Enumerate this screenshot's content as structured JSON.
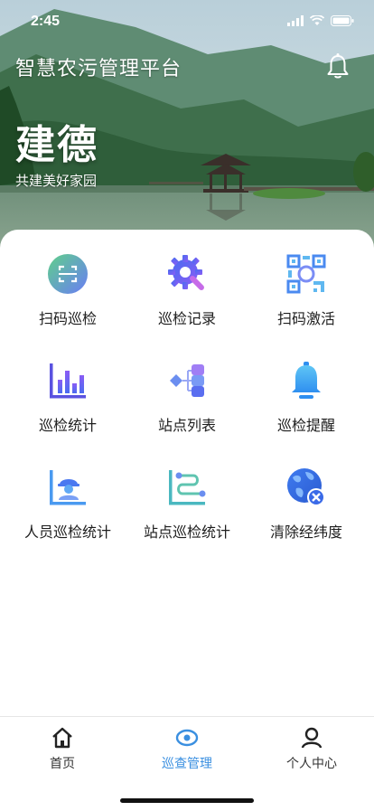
{
  "status_bar": {
    "time": "2:45"
  },
  "header": {
    "title": "智慧农污管理平台",
    "bell_icon": "bell-icon"
  },
  "hero": {
    "city": "建德",
    "slogan": "共建美好家园"
  },
  "menu": [
    {
      "label": "扫码巡检",
      "icon": "scan-code-icon"
    },
    {
      "label": "巡检记录",
      "icon": "gear-wrench-icon"
    },
    {
      "label": "扫码激活",
      "icon": "qr-code-icon"
    },
    {
      "label": "巡检统计",
      "icon": "bar-chart-icon"
    },
    {
      "label": "站点列表",
      "icon": "flow-list-icon"
    },
    {
      "label": "巡检提醒",
      "icon": "bell-icon"
    },
    {
      "label": "人员巡检统计",
      "icon": "worker-chart-icon"
    },
    {
      "label": "站点巡检统计",
      "icon": "route-chart-icon"
    },
    {
      "label": "清除经纬度",
      "icon": "globe-clear-icon"
    }
  ],
  "tabs": [
    {
      "label": "首页",
      "icon": "home-icon",
      "active": false
    },
    {
      "label": "巡查管理",
      "icon": "eye-icon",
      "active": true
    },
    {
      "label": "个人中心",
      "icon": "user-icon",
      "active": false
    }
  ],
  "colors": {
    "accent": "#3a8fe0",
    "icon_blue": "#4a6cf0",
    "icon_purple": "#7b5cf5",
    "icon_green": "#3ec28a"
  }
}
